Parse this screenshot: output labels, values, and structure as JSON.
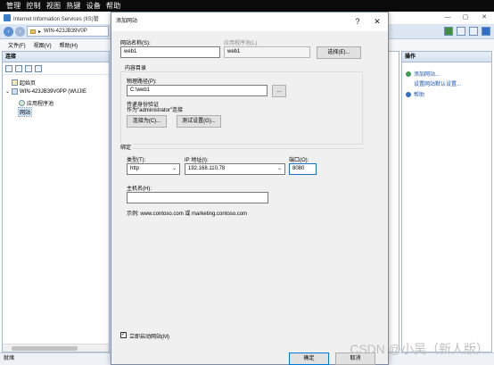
{
  "remote_menu": [
    "管理",
    "控制",
    "视图",
    "热键",
    "设备",
    "帮助"
  ],
  "iis": {
    "title": "Internet Information Services (IIS)管",
    "address": "WIN-423JB39V0P",
    "menu": [
      "文件(F)",
      "视图(V)",
      "帮助(H)"
    ],
    "connections_title": "连接",
    "tree": {
      "start_page": "起始页",
      "server": "WIN-423JB39V0PP (WUJIE",
      "app_pools": "应用程序池",
      "sites": "网站"
    },
    "actions_title": "操作",
    "actions": [
      "添加网站...",
      "设置网站默认设置...",
      "帮助"
    ],
    "status": "就绪"
  },
  "dialog": {
    "title": "添加网站",
    "help_glyph": "?",
    "close_glyph": "✕",
    "site_name_label": "网站名称(S):",
    "site_name_value": "web1",
    "app_pool_label": "应用程序池(L):",
    "app_pool_value": "web1",
    "select_button": "选择(E)...",
    "content_dir_label": "内容目录",
    "physical_path_label": "物理路径(P):",
    "physical_path_value": "C:\\web1",
    "browse_button": "...",
    "pass_through_label": "传递身份验证",
    "connect_as_text": "作为\"administrator\"连接",
    "connect_as_button": "连接为(C)...",
    "test_settings_button": "测试设置(G)...",
    "binding_label": "绑定",
    "type_label": "类型(T):",
    "type_value": "http",
    "ip_label": "IP 地址(I):",
    "ip_value": "192.168.110.78",
    "port_label": "端口(O):",
    "port_value": "8080",
    "hostname_label": "主机名(H):",
    "hostname_value": "",
    "example_text": "示例: www.contoso.com 或 marketing.contoso.com",
    "start_immediately_label": "立即启动网站(M)",
    "start_immediately_checked": "✓",
    "ok_button": "确定",
    "cancel_button": "取消"
  },
  "watermark": "CSDN @小吴（新人版）"
}
